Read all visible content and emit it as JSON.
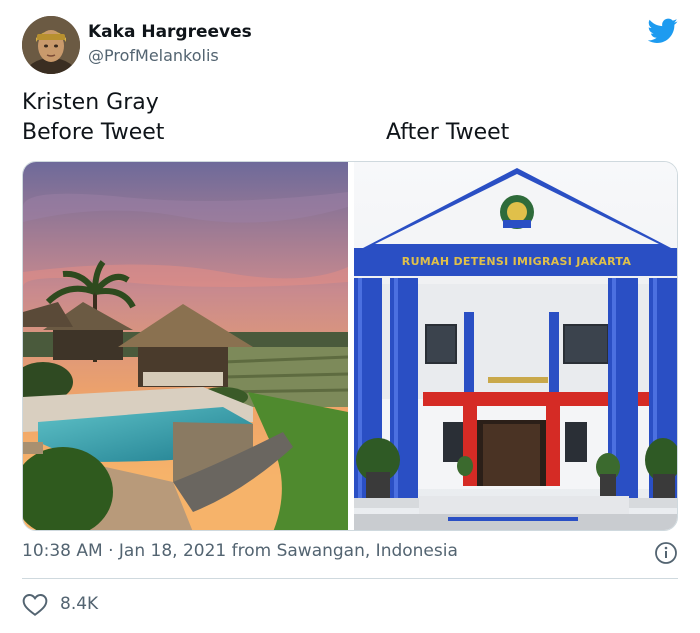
{
  "author": {
    "name": "Kaka Hargreeves",
    "handle": "@ProfMelankolis",
    "avatar_icon": "avatar-portrait"
  },
  "tweet": {
    "line1": "Kristen Gray",
    "line2": "Before Tweet",
    "after_label": "After Tweet"
  },
  "media": {
    "left_image": "resort-villa-pool-sunset",
    "right_image": "immigration-detention-building",
    "building_sign": "RUMAH DETENSI IMIGRASI JAKARTA",
    "accent_blue": "#2a4fc4",
    "accent_red": "#d52b25"
  },
  "meta": {
    "timestamp": "10:38 AM · Jan 18, 2021 from Sawangan, Indonesia"
  },
  "engagement": {
    "likes": "8.4K"
  },
  "colors": {
    "twitter_blue": "#1d9bf0",
    "secondary_text": "#536471"
  }
}
